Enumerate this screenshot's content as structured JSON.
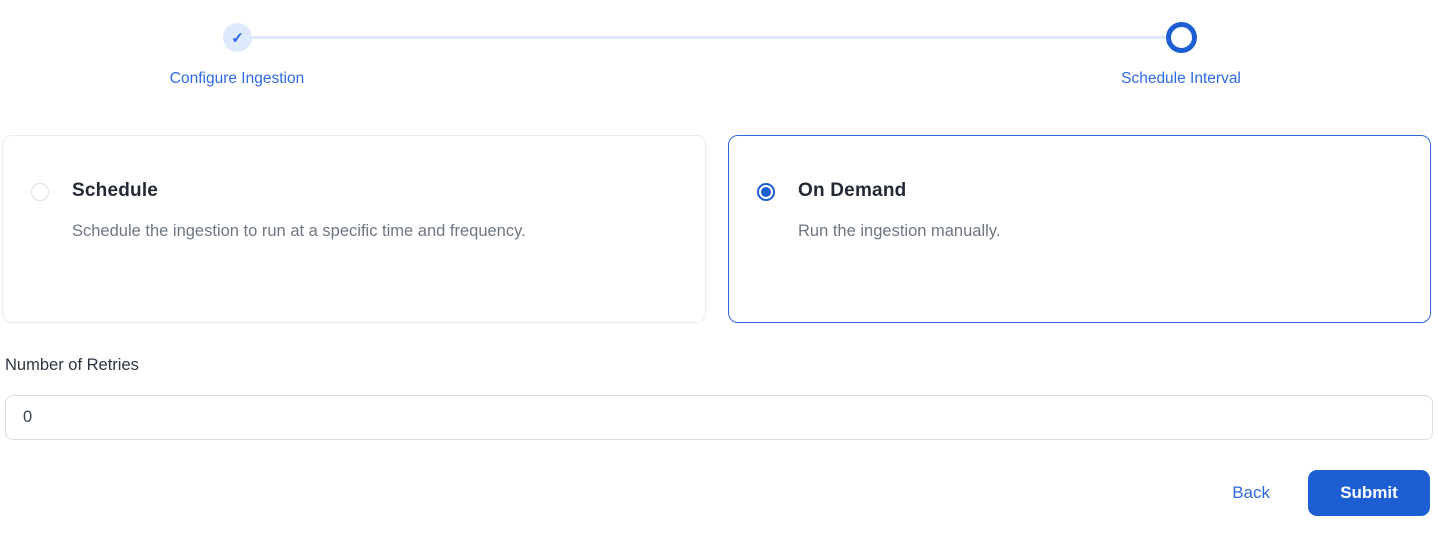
{
  "stepper": {
    "check_glyph": "✓",
    "steps": [
      {
        "label": "Configure Ingestion",
        "state": "completed"
      },
      {
        "label": "Schedule Interval",
        "state": "active"
      }
    ]
  },
  "options": [
    {
      "title": "Schedule",
      "description": "Schedule the ingestion to run at a specific time and frequency.",
      "selected": false
    },
    {
      "title": "On Demand",
      "description": "Run the ingestion manually.",
      "selected": true
    }
  ],
  "retries": {
    "label": "Number of Retries",
    "value": "0"
  },
  "footer": {
    "back_label": "Back",
    "submit_label": "Submit"
  },
  "colors": {
    "primary_blue": "#1d5ed2",
    "link_blue": "#2e6ae0",
    "step_done_bg": "#dceafc",
    "connector_line": "#dde9fb",
    "card_border": "#e9ebee",
    "selected_card_border": "#3068dd",
    "title_text": "#242a35",
    "muted_text": "#6e7683"
  }
}
